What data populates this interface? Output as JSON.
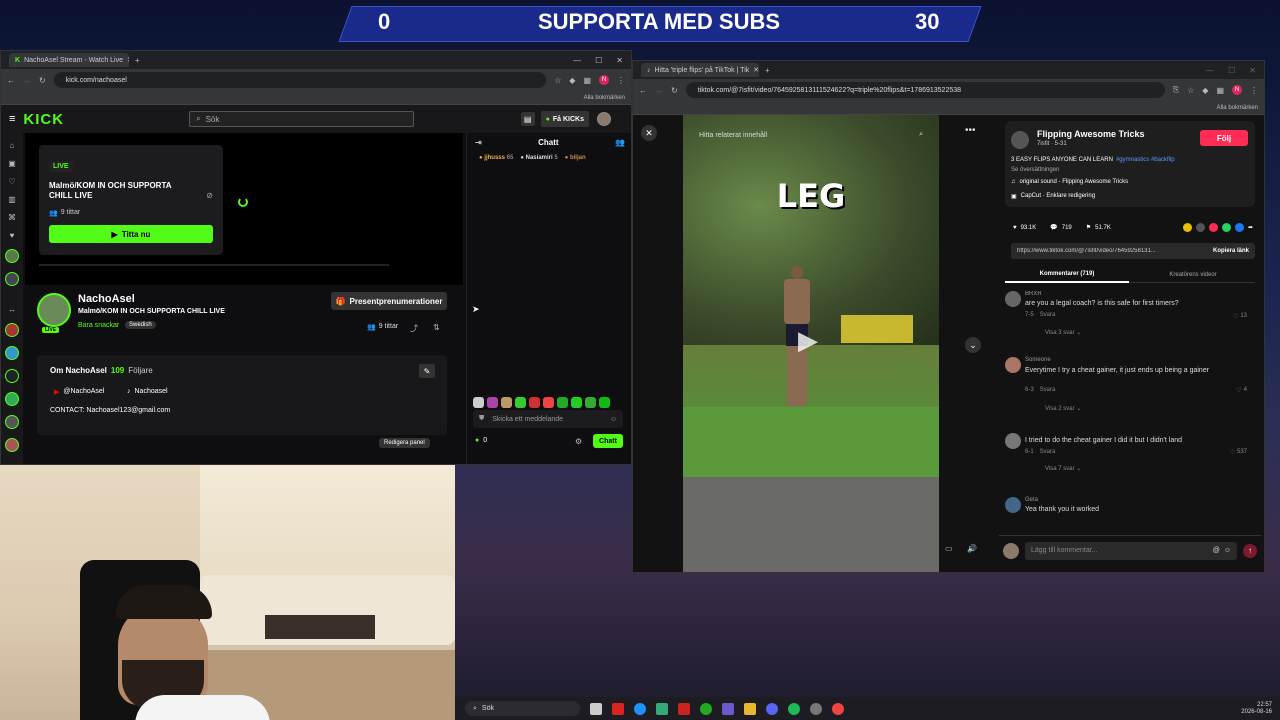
{
  "banner": {
    "left_count": "0",
    "title": "SUPPORTA MED SUBS",
    "right_count": "30"
  },
  "kick_window": {
    "tab_title": "NachoAsel Stream - Watch Live",
    "url": "kick.com/nachoasel",
    "bookmarks_label": "Alla bokmärken",
    "logo": "KICK",
    "search_placeholder": "Sök",
    "get_kicks": "Få KICKs",
    "live_badge": "LIVE",
    "card_title": "Malmö/KOM IN OCH SUPPORTA CHILL LIVE",
    "card_viewers": "9 tittar",
    "watch_now": "Titta nu",
    "streamer_name": "NachoAsel",
    "stream_title": "Malmö/KOM IN OCH SUPPORTA CHILL LIVE",
    "category": "Bara snackar",
    "language_tag": "Swedish",
    "avatar_live": "LIVE",
    "gift_subs_button": "Presentprenumerationer",
    "viewers": "9 tittar",
    "about_label": "Om NachoAsel",
    "followers_count": "109",
    "followers_label": "Följare",
    "youtube_handle": "@NachoAsel",
    "tiktok_handle": "Nachoasel",
    "contact": "CONTACT: Nachoasel123@gmail.com",
    "edit_panel": "Redigera panel",
    "chat_title": "Chatt",
    "chat_users": [
      {
        "name": "jjhusss",
        "count": "65"
      },
      {
        "name": "Nasiamiri",
        "count": "5"
      },
      {
        "name": "biljan",
        "count": ""
      }
    ],
    "chat_placeholder": "Skicka ett meddelande",
    "kicks_balance": "0",
    "chat_button": "Chatt"
  },
  "tiktok_window": {
    "tab_title": "Hitta 'triple flips' på TikTok | Tik",
    "url": "tiktok.com/@7isfit/video/7645925813111524622?q=triple%20flips&t=1786913522538",
    "bookmarks_label": "Alla bokmärken",
    "search_placeholder": "Hitta relaterat innehåll",
    "video_caption": "LEG",
    "author_name": "Flipping Awesome Tricks",
    "author_meta": "7isfit · 5-31",
    "follow_button": "Följ",
    "description": "3 EASY FLIPS ANYONE CAN LEARN",
    "hashtags": "#gymnastics #backflip",
    "see_translation": "Se översättningen",
    "sound": "original sound - Flipping Awesome Tricks",
    "capcut": "CapCut · Enklare redigering",
    "likes": "93.1K",
    "comments_count": "719",
    "saves": "51.7K",
    "share_url": "https://www.tiktok.com/@7isfit/video/76459258131...",
    "copy_link": "Kopiera länk",
    "tab_comments": "Kommentarer (719)",
    "tab_creator": "Kreatörens videor",
    "comments": [
      {
        "user": "BRXR",
        "text": "are you a legal coach? is this safe for first timers?",
        "meta": "7-5",
        "reply": "Svara",
        "likes": "13",
        "view_replies": "Visa 3 svar"
      },
      {
        "user": "Someone",
        "text": "Everytime I try a cheat gainer, it just ends up being a gainer",
        "meta": "6-3",
        "reply": "Svara",
        "likes": "4",
        "view_replies": "Visa 2 svar"
      },
      {
        "user": "",
        "text": "I tried to do the cheat gainer I did it but I didn't land",
        "meta": "6-1",
        "reply": "Svara",
        "likes": "537",
        "view_replies": "Visa 7 svar"
      },
      {
        "user": "Geta",
        "text": "Yea thank you it worked",
        "meta": "",
        "reply": "",
        "likes": "",
        "view_replies": ""
      }
    ],
    "add_comment_placeholder": "Lägg till kommentar..."
  },
  "taskbar": {
    "search_label": "Sök",
    "time": "22:57",
    "date": "2026-08-16"
  },
  "colors": {
    "kick_green": "#53fc18",
    "tiktok_red": "#fe2c55",
    "banner_blue": "#1a2a8a"
  }
}
